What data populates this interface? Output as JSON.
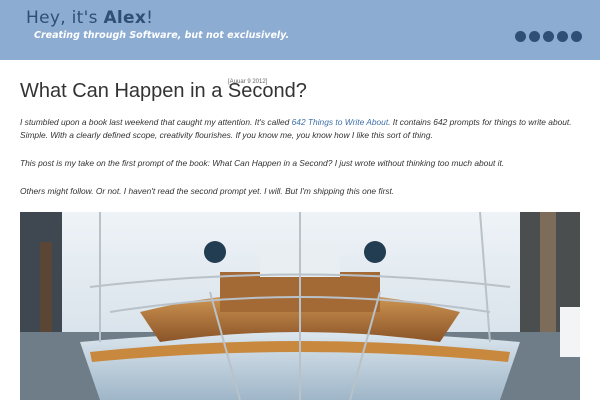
{
  "site": {
    "title_prefix": "Hey, it's ",
    "title_name": "Alex",
    "title_suffix": "!",
    "tagline": "Creating through Software, but not exclusively."
  },
  "social_icons": [
    "stack-overflow-icon",
    "flickr-icon",
    "github-icon",
    "twitter-icon",
    "rss-icon"
  ],
  "post": {
    "title": "What Can Happen in a Second?",
    "date": "[Auuar 9 2012]",
    "p1_a": "I stumbled upon a book last weekend that caught my attention. It's called ",
    "p1_link": "642 Things to Write About",
    "p1_b": ". It contains 642 prompts for things to write about. Simple. With a clearly defined scope, creativity flourishes. If you know me, you know how I like this sort of thing.",
    "p2": "This post is my take on the first prompt of the book: What Can Happen in a Second? I just wrote without thinking too much about it.",
    "p3": "Others might follow. Or not. I haven't read the second prompt yet. I will. But I'm shipping this one first."
  },
  "colors": {
    "header_bg": "#8cacd2",
    "title": "#2f4f77",
    "link": "#3d6fa8"
  }
}
